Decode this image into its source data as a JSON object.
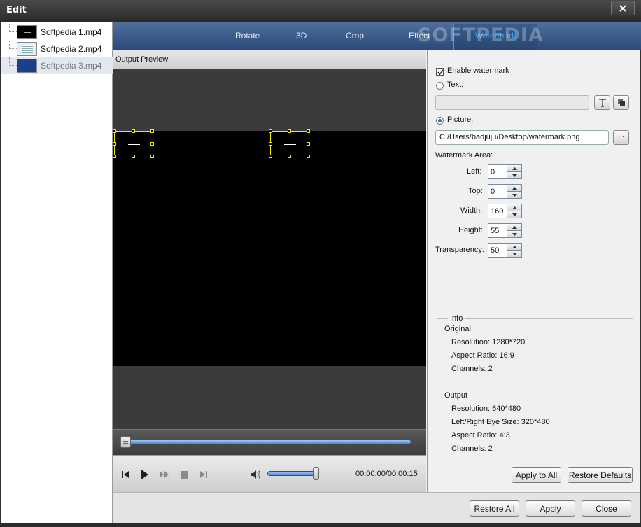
{
  "window": {
    "title": "Edit"
  },
  "files": [
    {
      "name": "Softpedia 1.mp4"
    },
    {
      "name": "Softpedia 2.mp4"
    },
    {
      "name": "Softpedia 3.mp4"
    }
  ],
  "tabs": [
    "Rotate",
    "3D",
    "Crop",
    "Effect",
    "Watermark"
  ],
  "overlay_text": "SOFTPEDIA",
  "preview": {
    "header": "Output Preview"
  },
  "player": {
    "time": "00:00:00/00:00:15",
    "seek_position": 0.0,
    "volume_level": 0.95
  },
  "watermark": {
    "enable_label": "Enable watermark",
    "enable_checked": true,
    "text_label": "Text:",
    "text_value": "",
    "picture_label": "Picture:",
    "picture_path": "C:/Users/badjuju/Desktop/watermark.png",
    "browse_label": "···",
    "area_label": "Watermark Area:",
    "fields": {
      "left": {
        "label": "Left:",
        "value": "0"
      },
      "top": {
        "label": "Top:",
        "value": "0"
      },
      "width": {
        "label": "Width:",
        "value": "160"
      },
      "height": {
        "label": "Height:",
        "value": "55"
      },
      "transparency": {
        "label": "Transparency:",
        "value": "50"
      }
    }
  },
  "info": {
    "title": "Info",
    "original": {
      "heading": "Original",
      "resolution": "Resolution: 1280*720",
      "aspect": "Aspect Ratio: 16:9",
      "channels": "Channels: 2"
    },
    "output": {
      "heading": "Output",
      "resolution": "Resolution: 640*480",
      "eye_size": "Left/Right Eye Size: 320*480",
      "aspect": "Aspect Ratio: 4:3",
      "channels": "Channels: 2"
    }
  },
  "buttons": {
    "apply_to_all": "Apply to All",
    "restore_defaults": "Restore Defaults",
    "restore_all": "Restore All",
    "apply": "Apply",
    "close": "Close"
  }
}
